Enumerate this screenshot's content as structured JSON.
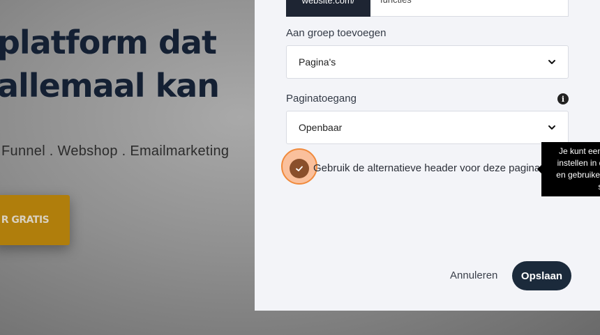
{
  "background": {
    "hero_title": "platform dat\nallemaal kan",
    "hero_subtitle": "Funnel . Webshop . Emailmarketing",
    "cta_label": "R GRATIS"
  },
  "modal": {
    "url": {
      "prefix": "website.com/",
      "value": "functies"
    },
    "group": {
      "label": "Aan groep toevoegen",
      "selected": "Pagina's"
    },
    "access": {
      "label": "Paginatoegang",
      "selected": "Openbaar",
      "info_icon": "info-icon"
    },
    "alt_header": {
      "label": "Gebruik de alternatieve header voor deze pagina",
      "checked": true
    },
    "buttons": {
      "cancel": "Annuleren",
      "save": "Opslaan"
    }
  },
  "tooltip": {
    "lines": [
      "Je kunt een",
      "instellen in d",
      "en gebruiken",
      "st"
    ]
  },
  "colors": {
    "accent_dark": "#1b2a3b",
    "checkbox": "#8a4f2b",
    "focus_ring": "#f08a3c",
    "cta": "#b07e0c"
  }
}
